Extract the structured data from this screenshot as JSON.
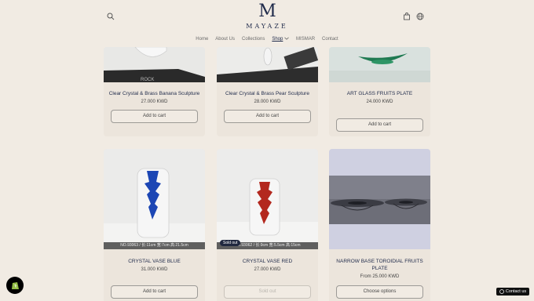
{
  "header": {
    "logo_letter": "M",
    "logo_text": "MAYAZE",
    "nav": [
      "Home",
      "About Us",
      "Collections",
      "Shop",
      "MISMAR",
      "Contact"
    ]
  },
  "products": [
    {
      "title": "Clear Crystal & Brass Banana Sculpture",
      "price": "27.000 KWD",
      "button": "Add to cart"
    },
    {
      "title": "Clear Crystal & Brass Pear Sculpture",
      "price": "28.000 KWD",
      "button": "Add to cart"
    },
    {
      "title": "ART GLASS FRUITS PLATE",
      "price": "24.000 KWD",
      "button": "Add to cart"
    },
    {
      "title": "CRYSTAL VASE BLUE",
      "price": "31.000 KWD",
      "button": "Add to cart",
      "caption": "NO.93063 / 长:11cm 宽:7cm 高:21.5cm"
    },
    {
      "title": "CRYSTAL VASE RED",
      "price": "27.000 KWD",
      "button": "Sold out",
      "badge": "Sold out",
      "caption": "NO.93062 / 长:9cm 宽:5.5cm 高:15cm"
    },
    {
      "title": "NARROW BASE TOROIDIAL FRUITS PLATE",
      "price": "From 25.000 KWD",
      "button": "Choose options"
    }
  ],
  "contact_label": "Contact us",
  "icons": [
    "search-icon",
    "cart-icon",
    "globe-icon",
    "chevron-down-icon",
    "shopify-icon",
    "whatsapp-icon"
  ]
}
